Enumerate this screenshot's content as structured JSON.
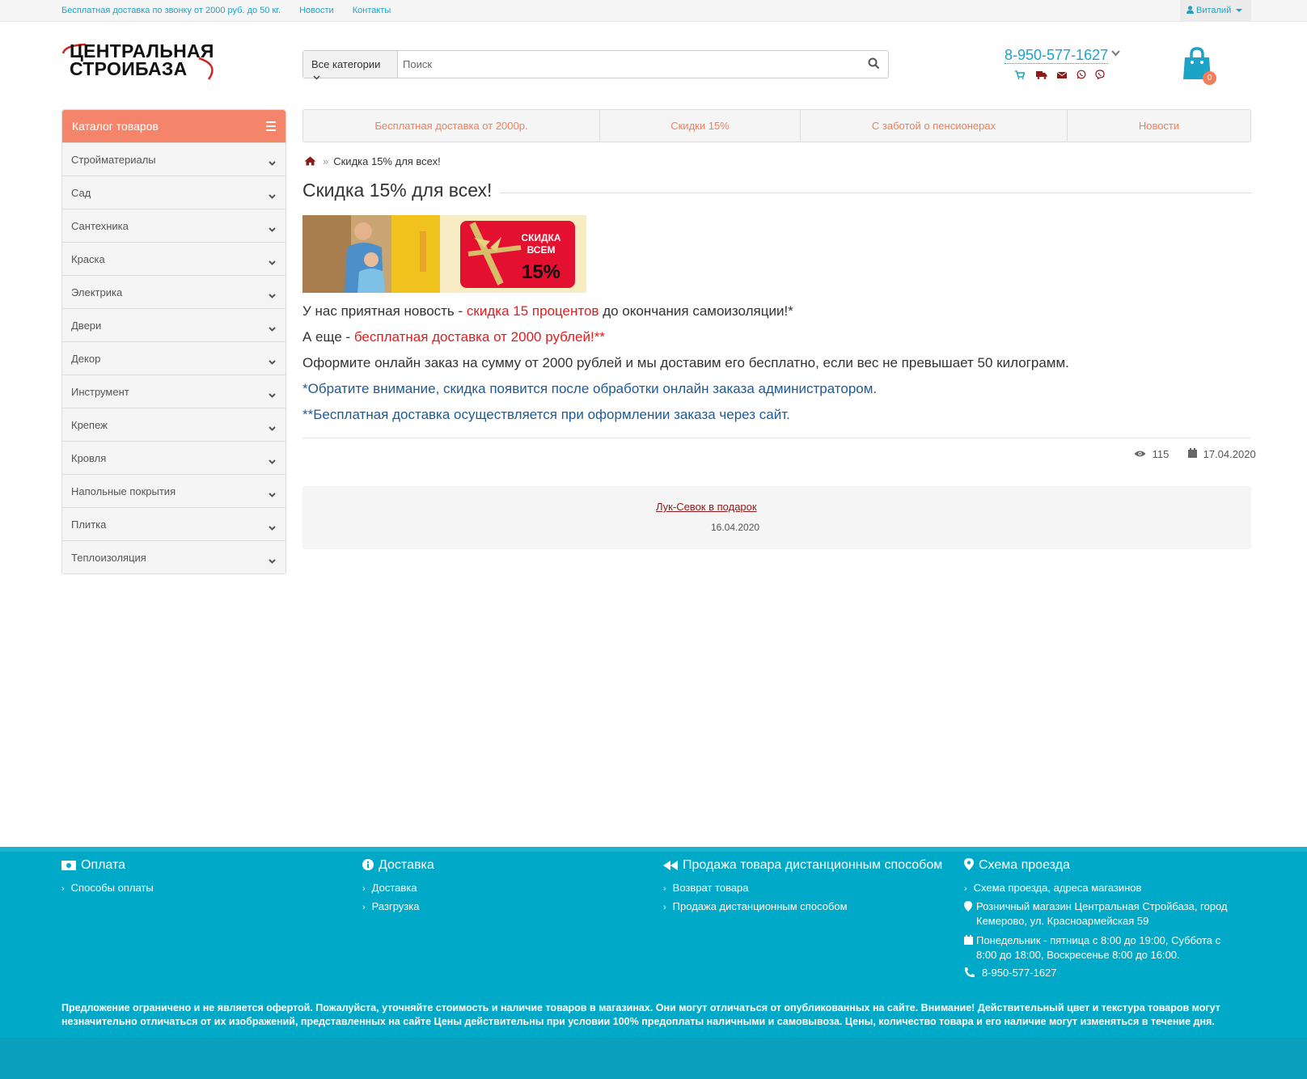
{
  "topbar": {
    "delivery_link": "Бесплатная доставка по звонку от 2000 руб. до 50 кг.",
    "news_link": "Новости",
    "contacts_link": "Контакты",
    "user_name": "Виталий"
  },
  "header": {
    "logo_line1": "ЦЕНТРАЛЬНАЯ",
    "logo_line2": "СТРОИБАЗА",
    "search_category": "Все категории",
    "search_placeholder": "Поиск",
    "phone": "8-950-577-1627",
    "cart_count": "0"
  },
  "catalog": {
    "title": "Каталог товаров",
    "items": [
      "Стройматериалы",
      "Сад",
      "Сантехника",
      "Краска",
      "Электрика",
      "Двери",
      "Декор",
      "Инструмент",
      "Крепеж",
      "Кровля",
      "Напольные покрытия",
      "Плитка",
      "Теплоизоляция"
    ]
  },
  "navtabs": [
    "Бесплатная доставка от 2000р.",
    "Скидки 15%",
    "С заботой о пенсионерах",
    "Новости"
  ],
  "breadcrumb": {
    "current": "Скидка 15% для всех!"
  },
  "article": {
    "title": "Скидка 15% для всех!",
    "banner_text1": "СКИДКА",
    "banner_text2": "ВСЕМ",
    "banner_text3": "15%",
    "p1_a": "У нас приятная новость - ",
    "p1_b": "скидка 15 процентов",
    "p1_c": " до окончания самоизоляции!*",
    "p2_a": "А еще - ",
    "p2_b": "бесплатная доставка от 2000 рублей!**",
    "p3": "Оформите онлайн заказ на сумму от 2000 рублей и мы доставим его бесплатно, если вес не превышает 50 килограмм.",
    "p4": "*Обратите внимание, скидка появится после обработки онлайн заказа администратором.",
    "p5": "**Бесплатная доставка осуществляется при оформлении заказа через сайт.",
    "views": "115",
    "date": "17.04.2020"
  },
  "related": {
    "title": "Лук-Севок в подарок",
    "date": "16.04.2020"
  },
  "footer": {
    "col1": {
      "title": "Оплата",
      "links": [
        "Способы оплаты"
      ]
    },
    "col2": {
      "title": "Доставка",
      "links": [
        "Доставка",
        "Разгрузка"
      ]
    },
    "col3": {
      "title": "Продажа товара дистанционным способом",
      "links": [
        "Возврат товара",
        "Продажа дистанционным способом"
      ]
    },
    "col4": {
      "title": "Схема проезда",
      "link": "Схема проезда, адреса магазинов",
      "address": "Розничный магазин Центральная Стройбаза, город Кемерово, ул. Красноармейская 59",
      "hours": "Понедельник - пятница с 8:00 до 19:00, Суббота с 8:00 до 18:00, Воскресенье 8:00 до 16:00.",
      "phone": "8-950-577-1627"
    },
    "disclaimer": "Предложение ограничено и не является офертой. Пожалуйста, уточняйте стоимость и наличие товаров в магазинах. Они могут отличаться от опубликованных на сайте. Внимание! Действительный цвет и текстура товаров могут незначительно отличаться от их изображений, представленных на сайте Цены действительны при условии 100% предоплаты наличными и самовывоза. Цены, количество товара и его наличие могут изменяться в течение дня."
  },
  "colors": {
    "accent": "#f4856a",
    "link": "#1da3c8",
    "footer": "#00a9c8",
    "red": "#e8191b",
    "blue": "#1e5a96"
  }
}
